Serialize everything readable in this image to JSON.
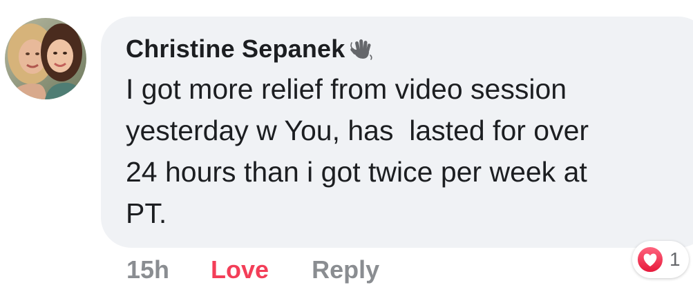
{
  "comment": {
    "author": "Christine Sepanek",
    "author_badge_icon": "waving-hand-icon",
    "text": "I got more relief from video session\nyesterday w You, has  lasted for over\n24 hours than i got twice per week at\nPT.",
    "avatar_icon": "profile-photo"
  },
  "actions": {
    "timestamp": "15h",
    "love_label": "Love",
    "reply_label": "Reply"
  },
  "reactions": {
    "icon": "love-reaction-icon",
    "count": "1"
  },
  "colors": {
    "bubble": "#f0f2f5",
    "text": "#1c1e21",
    "muted": "#8a8d91",
    "love": "#f33e58"
  }
}
